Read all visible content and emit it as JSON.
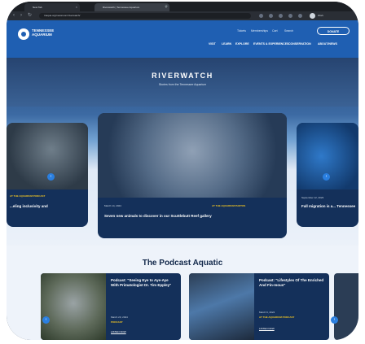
{
  "browser": {
    "tabs": [
      {
        "label": "New Tab"
      },
      {
        "label": "Riverwatch | Tennessee Aquarium"
      }
    ],
    "new_tab_symbol": "+",
    "url": "tnaqua.org/newsroom/riverwatch/",
    "profile_label": "Work"
  },
  "header": {
    "logo_text": "TENNESSEE AQUARIUM",
    "utility_links": [
      "Tickets",
      "Memberships",
      "Cart",
      "Search"
    ],
    "donate_label": "DONATE",
    "main_nav": [
      "VISIT",
      "LEARN",
      "EXPLORE",
      "EVENTS & EXPERIENCES",
      "CONSERVATION",
      "ABOUT/NEWS"
    ]
  },
  "hero": {
    "title": "RIVERWATCH",
    "subtitle": "Stories from the Tennessee Aquarium"
  },
  "featured": [
    {
      "tag": "AT THE AQUARIUM   PODCAST",
      "date": "",
      "title": "...eling inclusivity and"
    },
    {
      "tag": "AT THE AQUARIUM   PHOTOS",
      "date": "March 14, 2024",
      "title": "Seven new animals to discover in our Scuttlebutt Reef gallery"
    },
    {
      "tag": "",
      "date": "September 12, 2023",
      "title": "Fall migration is a... Tennessee"
    }
  ],
  "podcast": {
    "heading": "The Podcast Aquatic",
    "episodes": [
      {
        "title": "Podcast: \"Seeing Eye to Aye-Aye With Primatologist Dr. Tim Eppley\"",
        "date": "March 20, 2024",
        "tag": "PODCAST",
        "link": "LISTEN NOW"
      },
      {
        "title": "Podcast: \"Lifestyles Of The Enriched And Fin-mous\"",
        "date": "March 6, 2024",
        "tag": "AT THE AQUARIUM   PODCAST",
        "link": "LISTEN NOW"
      }
    ]
  },
  "colors": {
    "brand_blue": "#1f5fb2",
    "accent_yellow": "#f3c623",
    "navy": "#13294b"
  },
  "icons": {
    "carousel_prev": "chevron-left-icon",
    "carousel_next": "chevron-right-icon"
  }
}
